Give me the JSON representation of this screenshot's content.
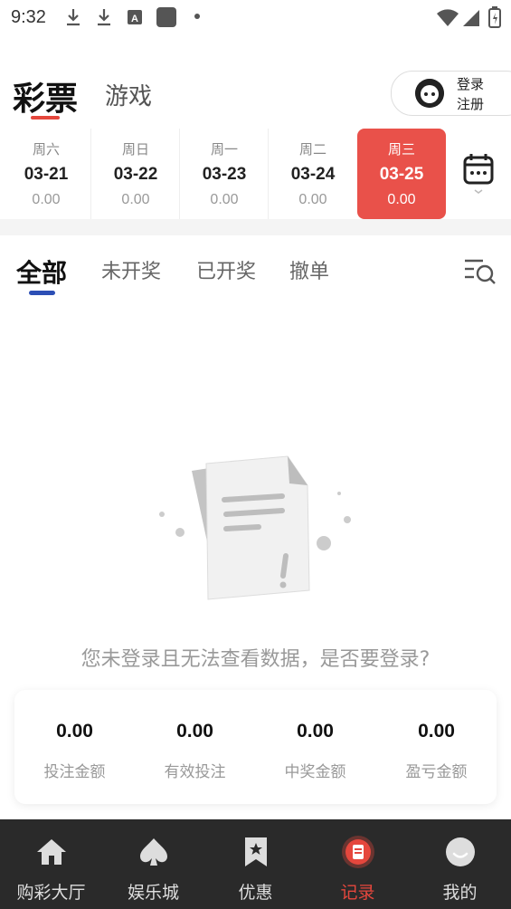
{
  "status_bar": {
    "time": "9:32"
  },
  "header": {
    "tab_lottery": "彩票",
    "tab_game": "游戏",
    "login": {
      "line1": "登录",
      "line2": "注册"
    }
  },
  "dates": [
    {
      "weekday": "周六",
      "date": "03-21",
      "amount": "0.00",
      "active": false
    },
    {
      "weekday": "周日",
      "date": "03-22",
      "amount": "0.00",
      "active": false
    },
    {
      "weekday": "周一",
      "date": "03-23",
      "amount": "0.00",
      "active": false
    },
    {
      "weekday": "周二",
      "date": "03-24",
      "amount": "0.00",
      "active": false
    },
    {
      "weekday": "周三",
      "date": "03-25",
      "amount": "0.00",
      "active": true
    }
  ],
  "filter_tabs": [
    "全部",
    "未开奖",
    "已开奖",
    "撤单"
  ],
  "empty_message": "您未登录且无法查看数据，是否要登录?",
  "summary": [
    {
      "value": "0.00",
      "label": "投注金额"
    },
    {
      "value": "0.00",
      "label": "有效投注"
    },
    {
      "value": "0.00",
      "label": "中奖金额"
    },
    {
      "value": "0.00",
      "label": "盈亏金额"
    }
  ],
  "bottom_nav": [
    {
      "label": "购彩大厅",
      "icon": "home-icon"
    },
    {
      "label": "娱乐城",
      "icon": "spade-icon"
    },
    {
      "label": "优惠",
      "icon": "bookmark-star-icon"
    },
    {
      "label": "记录",
      "icon": "record-icon",
      "active": true
    },
    {
      "label": "我的",
      "icon": "profile-icon"
    }
  ],
  "colors": {
    "accent": "#e9514a",
    "nav_bg": "#2a2a2a",
    "filter_underline": "#2c4fb5"
  }
}
